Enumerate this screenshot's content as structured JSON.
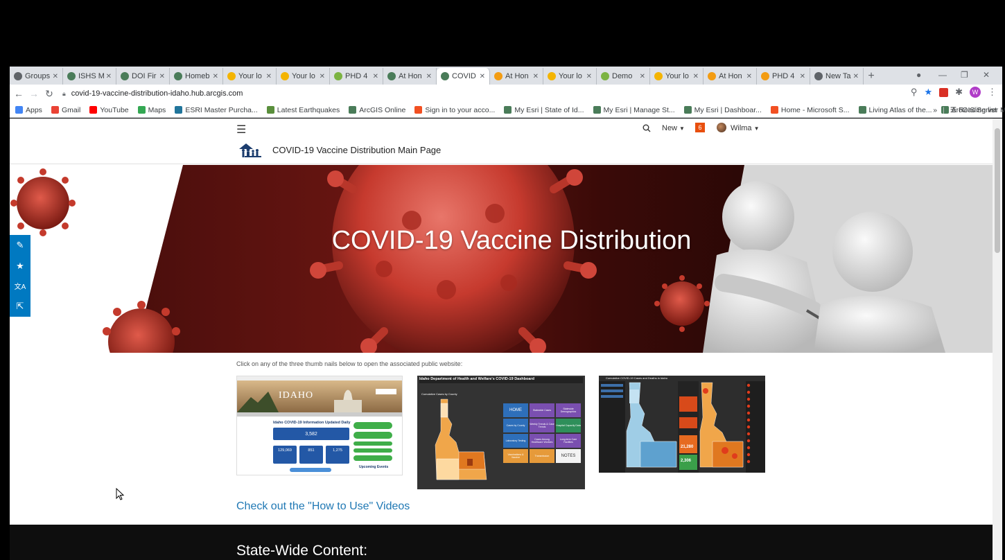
{
  "browser": {
    "tabs": [
      {
        "title": "Groups",
        "favicon_color": "#5f6368"
      },
      {
        "title": "ISHS M",
        "favicon_color": "#4a7c59"
      },
      {
        "title": "DOI Fir",
        "favicon_color": "#4a7c59"
      },
      {
        "title": "Homeb",
        "favicon_color": "#4a7c59"
      },
      {
        "title": "Your lo",
        "favicon_color": "#f4b400"
      },
      {
        "title": "Your lo",
        "favicon_color": "#f4b400"
      },
      {
        "title": "PHD 4",
        "favicon_color": "#7cb342"
      },
      {
        "title": "At Hon",
        "favicon_color": "#4a7c59"
      },
      {
        "title": "COVID",
        "favicon_color": "#4a7c59"
      },
      {
        "title": "At Hon",
        "favicon_color": "#f39c12"
      },
      {
        "title": "Your lo",
        "favicon_color": "#f4b400"
      },
      {
        "title": "Demo",
        "favicon_color": "#7cb342"
      },
      {
        "title": "Your lo",
        "favicon_color": "#f4b400"
      },
      {
        "title": "At Hon",
        "favicon_color": "#f39c12"
      },
      {
        "title": "PHD 4",
        "favicon_color": "#f39c12"
      },
      {
        "title": "New Ta",
        "favicon_color": "#5f6368"
      }
    ],
    "active_tab_index": 8,
    "url": "covid-19-vaccine-distribution-idaho.hub.arcgis.com",
    "profile_initial": "W",
    "bookmarks": [
      {
        "label": "Apps",
        "color": "#4285f4"
      },
      {
        "label": "Gmail",
        "color": "#ea4335"
      },
      {
        "label": "YouTube",
        "color": "#ff0000"
      },
      {
        "label": "Maps",
        "color": "#34a853"
      },
      {
        "label": "ESRI Master Purcha...",
        "color": "#21759b"
      },
      {
        "label": "Latest Earthquakes",
        "color": "#5a8f3c"
      },
      {
        "label": "ArcGIS Online",
        "color": "#4a7c59"
      },
      {
        "label": "Sign in to your acco...",
        "color": "#f25022"
      },
      {
        "label": "My Esri | State of Id...",
        "color": "#4a7c59"
      },
      {
        "label": "My Esri | Manage St...",
        "color": "#4a7c59"
      },
      {
        "label": "My Esri | Dashboar...",
        "color": "#4a7c59"
      },
      {
        "label": "Home - Microsoft S...",
        "color": "#f25022"
      },
      {
        "label": "Living Atlas of the...",
        "color": "#4a7c59"
      },
      {
        "label": "ArcGIS Server Mana...",
        "color": "#4a7c59"
      }
    ],
    "more_bookmarks": "»",
    "reading_list": "Reading list"
  },
  "hub": {
    "site_title": "COVID-19 Vaccine Distribution Main Page",
    "new_label": "New",
    "notification_count": "6",
    "user_name": "Wilma",
    "hero_title": "COVID-19 Vaccine Distribution",
    "instructions": "Click on any of the three thumb nails below to open the associated public website:",
    "videos_link": "Check out the \"How to Use\" Videos",
    "statewide_heading": "State-Wide Content:"
  },
  "thumbnails": {
    "t1": {
      "header": "IDAHO",
      "headline": "Idaho COVID-19 Information Updated Daily",
      "big_stat": "3,582",
      "stats": [
        "129,069",
        "851",
        "1,275"
      ],
      "events_label": "Upcoming Events"
    },
    "t2": {
      "title": "Idaho Department of Health and Welfare's COVID-19 Dashboard",
      "map_caption": "Cumulative Cases by County",
      "tiles": [
        "HOME",
        "Statewide Cases",
        "Statewide Demographics",
        "Cases by County",
        "Weekly Trends & Case Trends",
        "Hospital Capacity Data",
        "Laboratory Testing",
        "Cases Among Healthcare Workers",
        "Long-term Care Facilities",
        "Vaccinations & Vaccine",
        "Transmission",
        "NOTES"
      ]
    },
    "t3": {
      "title": "Cumulative COVID-19 Cases and Deaths in Idaho",
      "stat_values": [
        "21,280",
        "2,306"
      ]
    }
  },
  "colors": {
    "esri_blue": "#0079c1",
    "link_blue": "#1f78b4",
    "notif_orange": "#e84f0e"
  }
}
